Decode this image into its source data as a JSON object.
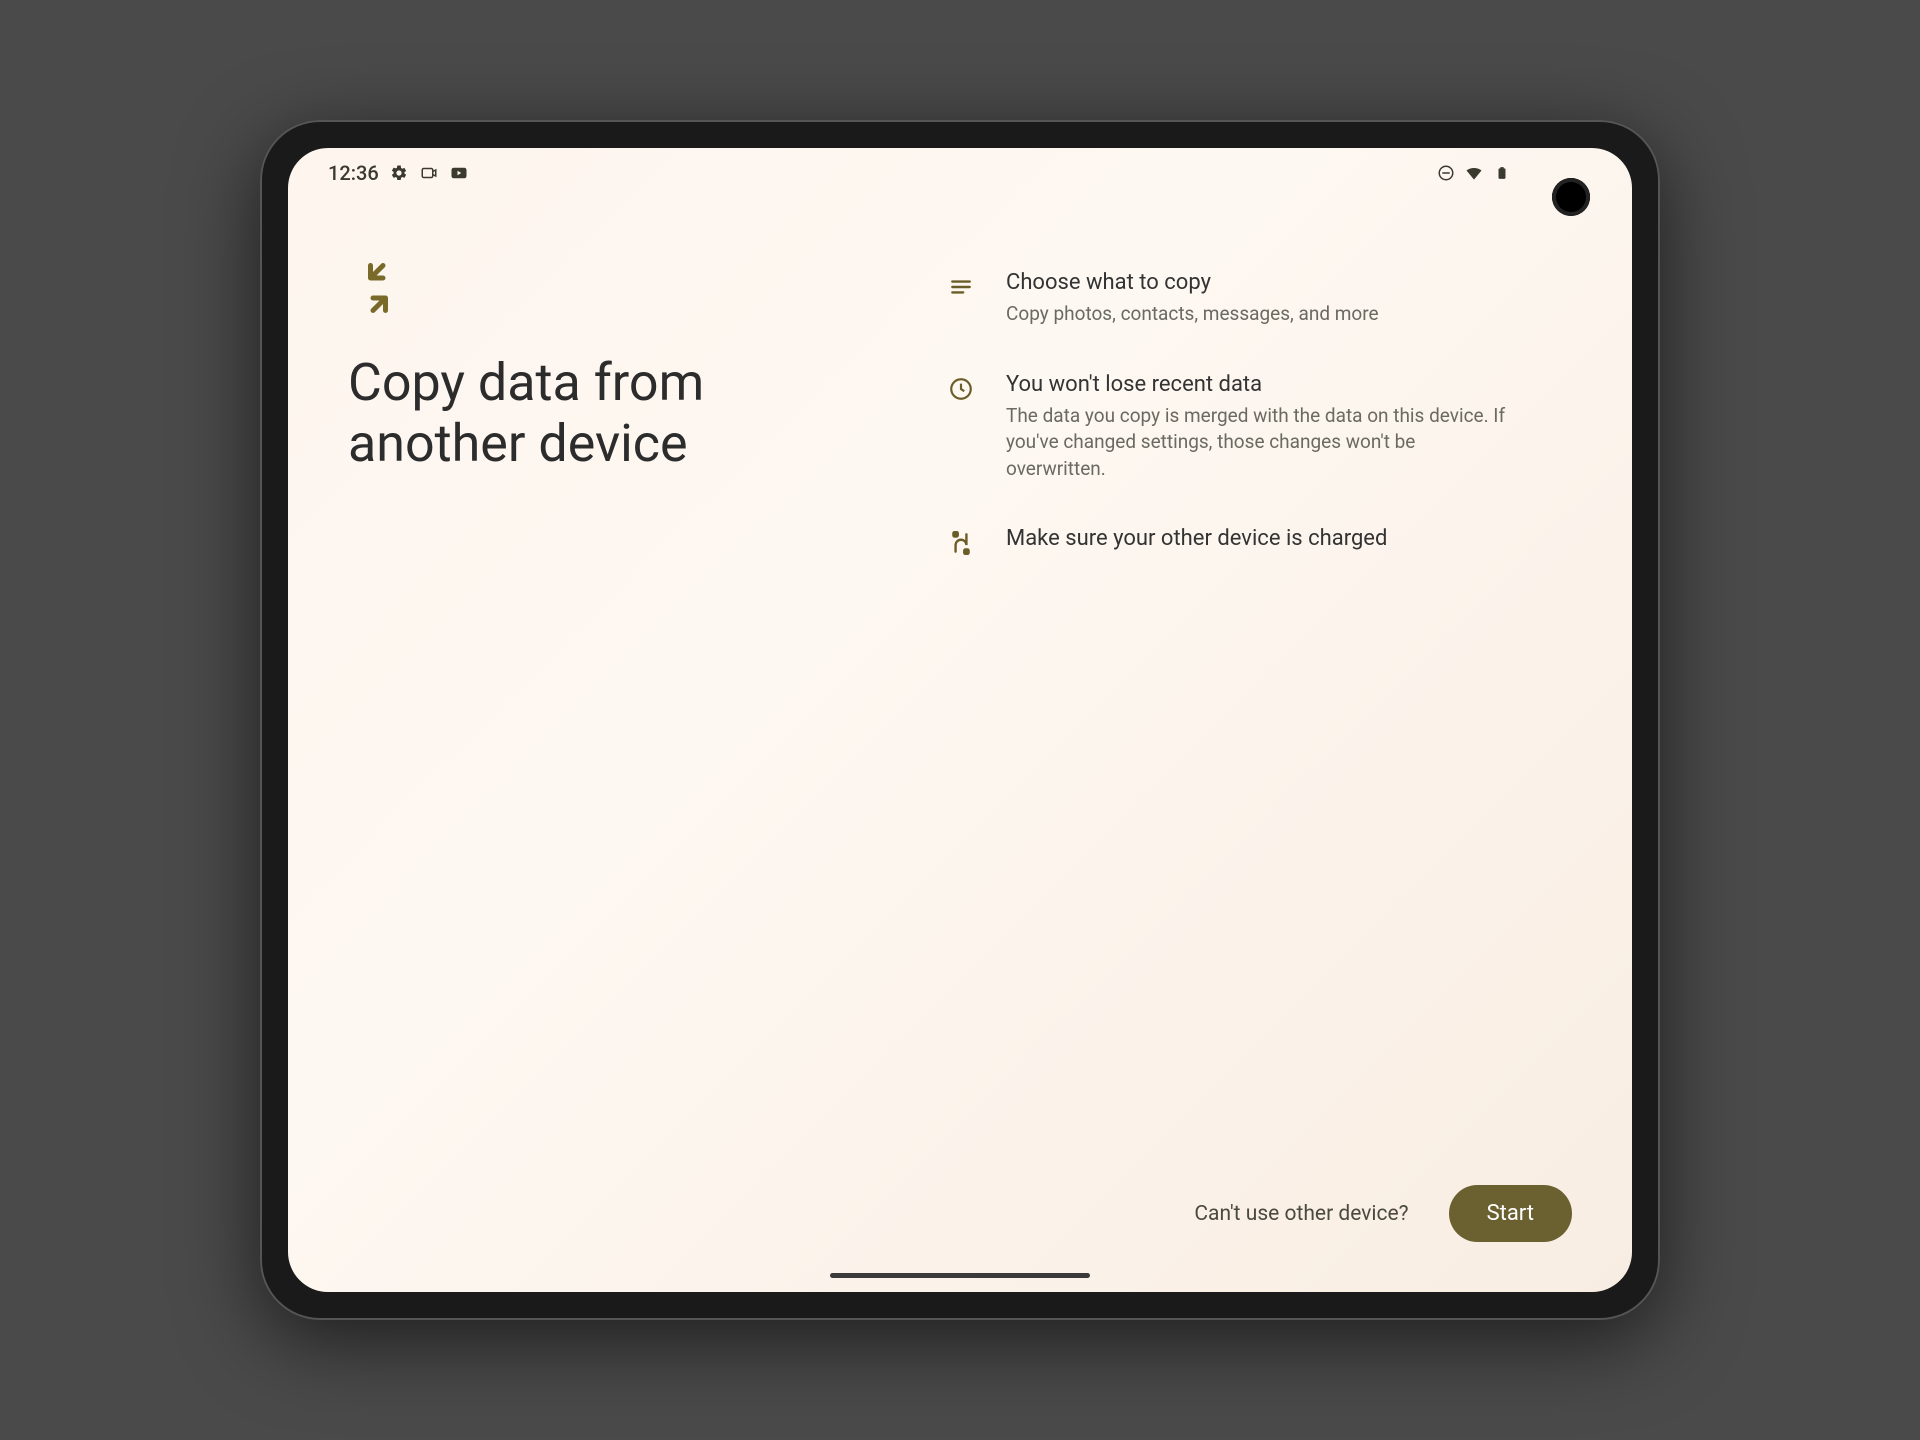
{
  "status": {
    "time": "12:36",
    "icons_left": [
      "settings-icon",
      "camera-icon",
      "youtube-icon"
    ],
    "icons_right": [
      "dnd-icon",
      "wifi-icon",
      "battery-icon"
    ]
  },
  "main": {
    "title": "Copy data from another device"
  },
  "info": [
    {
      "icon": "list-icon",
      "title": "Choose what to copy",
      "desc": "Copy photos, contacts, messages, and more"
    },
    {
      "icon": "clock-icon",
      "title": "You won't lose recent data",
      "desc": "The data you copy is merged with the data on this device. If you've changed settings, those changes won't be overwritten."
    },
    {
      "icon": "cable-icon",
      "title": "Make sure your other device is charged",
      "desc": ""
    }
  ],
  "footer": {
    "secondary": "Can't use other device?",
    "primary": "Start"
  }
}
